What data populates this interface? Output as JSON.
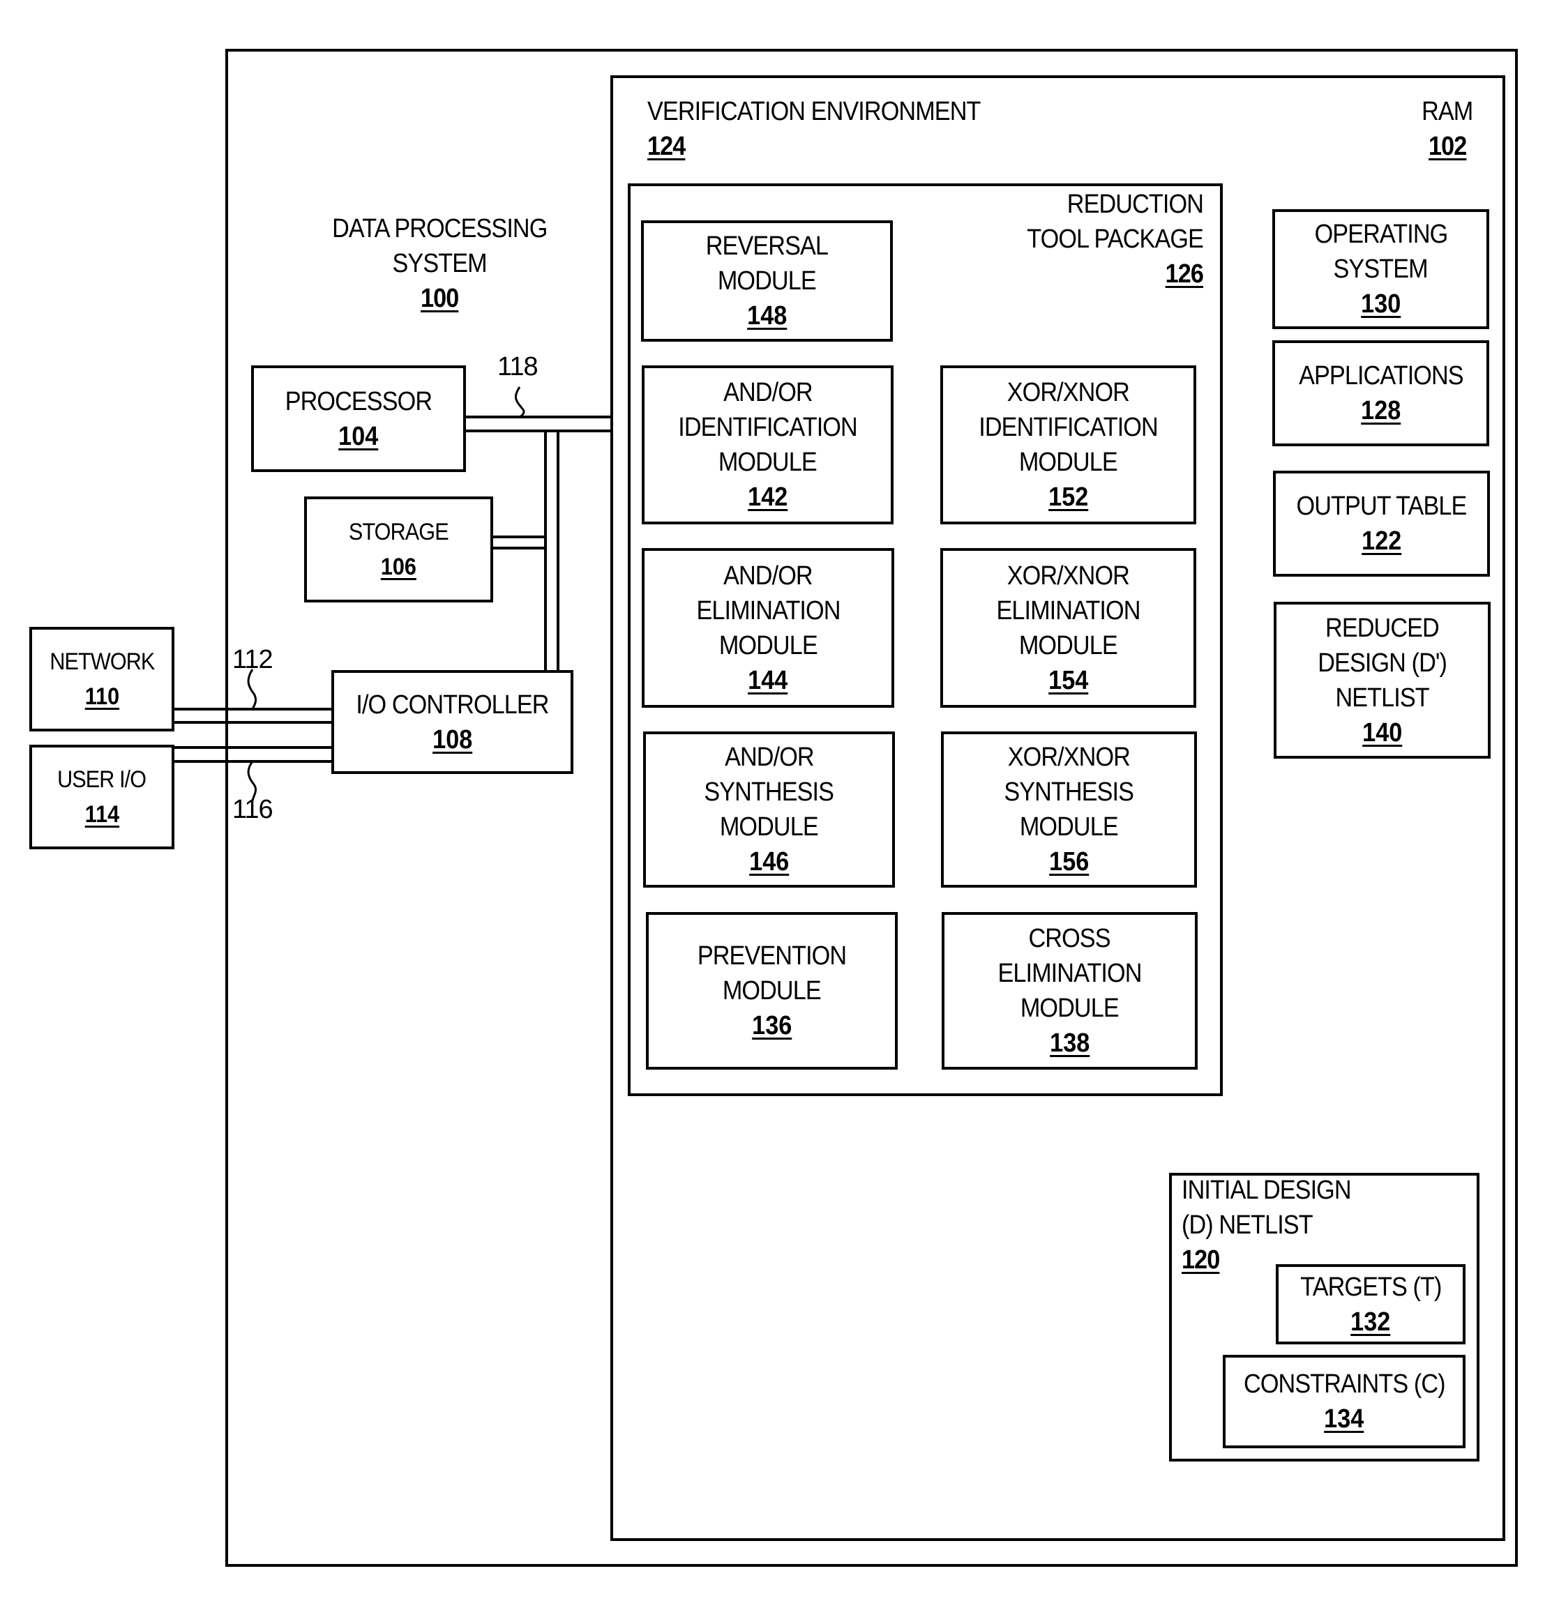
{
  "data_processing_system": {
    "title_line1": "DATA PROCESSING",
    "title_line2": "SYSTEM",
    "ref": "100"
  },
  "processor": {
    "label": "PROCESSOR",
    "ref": "104"
  },
  "storage": {
    "label": "STORAGE",
    "ref": "106"
  },
  "io_controller": {
    "label": "I/O CONTROLLER",
    "ref": "108"
  },
  "network": {
    "label": "NETWORK",
    "ref": "110"
  },
  "user_io": {
    "label": "USER I/O",
    "ref": "114"
  },
  "bus_refs": {
    "system_bus": "118",
    "network_link": "112",
    "user_io_link": "116"
  },
  "ram": {
    "label": "RAM",
    "ref": "102"
  },
  "verification_environment": {
    "label": "VERIFICATION ENVIRONMENT",
    "ref": "124"
  },
  "reduction_tool_package": {
    "line1": "REDUCTION",
    "line2": "TOOL PACKAGE",
    "ref": "126"
  },
  "modules": {
    "reversal": {
      "lines": [
        "REVERSAL",
        "MODULE"
      ],
      "ref": "148"
    },
    "and_or_identification": {
      "lines": [
        "AND/OR",
        "IDENTIFICATION",
        "MODULE"
      ],
      "ref": "142"
    },
    "xor_xnor_identification": {
      "lines": [
        "XOR/XNOR",
        "IDENTIFICATION",
        "MODULE"
      ],
      "ref": "152"
    },
    "and_or_elimination": {
      "lines": [
        "AND/OR",
        "ELIMINATION",
        "MODULE"
      ],
      "ref": "144"
    },
    "xor_xnor_elimination": {
      "lines": [
        "XOR/XNOR",
        "ELIMINATION",
        "MODULE"
      ],
      "ref": "154"
    },
    "and_or_synthesis": {
      "lines": [
        "AND/OR",
        "SYNTHESIS",
        "MODULE"
      ],
      "ref": "146"
    },
    "xor_xnor_synthesis": {
      "lines": [
        "XOR/XNOR",
        "SYNTHESIS",
        "MODULE"
      ],
      "ref": "156"
    },
    "prevention": {
      "lines": [
        "PREVENTION",
        "MODULE"
      ],
      "ref": "136"
    },
    "cross_elimination": {
      "lines": [
        "CROSS",
        "ELIMINATION",
        "MODULE"
      ],
      "ref": "138"
    }
  },
  "operating_system": {
    "lines": [
      "OPERATING",
      "SYSTEM"
    ],
    "ref": "130"
  },
  "applications": {
    "lines": [
      "APPLICATIONS"
    ],
    "ref": "128"
  },
  "output_table": {
    "lines": [
      "OUTPUT TABLE"
    ],
    "ref": "122"
  },
  "reduced_netlist": {
    "lines": [
      "REDUCED",
      "DESIGN (D')",
      "NETLIST"
    ],
    "ref": "140"
  },
  "initial_netlist": {
    "line1": "INITIAL DESIGN",
    "line2": "(D) NETLIST",
    "ref": "120"
  },
  "targets": {
    "label": "TARGETS (T)",
    "ref": "132"
  },
  "constraints": {
    "label": "CONSTRAINTS (C)",
    "ref": "134"
  }
}
